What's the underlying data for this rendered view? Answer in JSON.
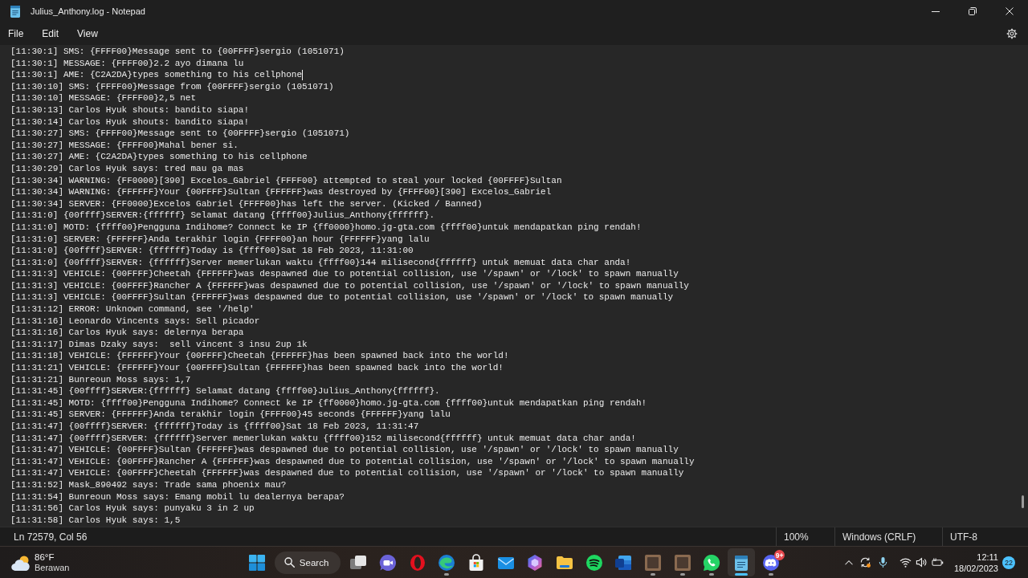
{
  "window": {
    "title": "Julius_Anthony.log - Notepad"
  },
  "menu": [
    "File",
    "Edit",
    "View"
  ],
  "editor": {
    "lines": [
      {
        "text": "[11:30:1] SMS: {FFFF00}Message sent to {00FFFF}sergio (1051071)",
        "caret": false
      },
      {
        "text": "[11:30:1] MESSAGE: {FFFF00}2.2 ayo dimana lu",
        "caret": false
      },
      {
        "text": "[11:30:1] AME: {C2A2DA}types something to his cellphone",
        "caret": true
      },
      {
        "text": "[11:30:10] SMS: {FFFF00}Message from {00FFFF}sergio (1051071)",
        "caret": false
      },
      {
        "text": "[11:30:10] MESSAGE: {FFFF00}2,5 net",
        "caret": false
      },
      {
        "text": "[11:30:13] Carlos Hyuk shouts: bandito siapa!",
        "caret": false
      },
      {
        "text": "[11:30:14] Carlos Hyuk shouts: bandito siapa!",
        "caret": false
      },
      {
        "text": "[11:30:27] SMS: {FFFF00}Message sent to {00FFFF}sergio (1051071)",
        "caret": false
      },
      {
        "text": "[11:30:27] MESSAGE: {FFFF00}Mahal bener si.",
        "caret": false
      },
      {
        "text": "[11:30:27] AME: {C2A2DA}types something to his cellphone",
        "caret": false
      },
      {
        "text": "[11:30:29] Carlos Hyuk says: tred mau ga mas",
        "caret": false
      },
      {
        "text": "[11:30:34] WARNING: {FF0000}[390] Excelos_Gabriel {FFFF00} attempted to steal your locked {00FFFF}Sultan",
        "caret": false
      },
      {
        "text": "[11:30:34] WARNING: {FFFFFF}Your {00FFFF}Sultan {FFFFFF}was destroyed by {FFFF00}[390] Excelos_Gabriel",
        "caret": false
      },
      {
        "text": "[11:30:34] SERVER: {FF0000}Excelos Gabriel {FFFF00}has left the server. (Kicked / Banned)",
        "caret": false
      },
      {
        "text": "[11:31:0] {00ffff}SERVER:{ffffff} Selamat datang {ffff00}Julius_Anthony{ffffff}.",
        "caret": false
      },
      {
        "text": "[11:31:0] MOTD: {ffff00}Pengguna Indihome? Connect ke IP {ff0000}homo.jg-gta.com {ffff00}untuk mendapatkan ping rendah!",
        "caret": false
      },
      {
        "text": "[11:31:0] SERVER: {FFFFFF}Anda terakhir login {FFFF00}an hour {FFFFFF}yang lalu",
        "caret": false
      },
      {
        "text": "[11:31:0] {00ffff}SERVER: {ffffff}Today is {ffff00}Sat 18 Feb 2023, 11:31:00",
        "caret": false
      },
      {
        "text": "[11:31:0] {00ffff}SERVER: {ffffff}Server memerlukan waktu {ffff00}144 milisecond{ffffff} untuk memuat data char anda!",
        "caret": false
      },
      {
        "text": "[11:31:3] VEHICLE: {00FFFF}Cheetah {FFFFFF}was despawned due to potential collision, use '/spawn' or '/lock' to spawn manually",
        "caret": false
      },
      {
        "text": "[11:31:3] VEHICLE: {00FFFF}Rancher A {FFFFFF}was despawned due to potential collision, use '/spawn' or '/lock' to spawn manually",
        "caret": false
      },
      {
        "text": "[11:31:3] VEHICLE: {00FFFF}Sultan {FFFFFF}was despawned due to potential collision, use '/spawn' or '/lock' to spawn manually",
        "caret": false
      },
      {
        "text": "[11:31:12] ERROR: Unknown command, see '/help'",
        "caret": false
      },
      {
        "text": "[11:31:16] Leonardo Vincents says: Sell picador",
        "caret": false
      },
      {
        "text": "[11:31:16] Carlos Hyuk says: delernya berapa",
        "caret": false
      },
      {
        "text": "[11:31:17] Dimas Dzaky says:  sell vincent 3 insu 2up 1k",
        "caret": false
      },
      {
        "text": "[11:31:18] VEHICLE: {FFFFFF}Your {00FFFF}Cheetah {FFFFFF}has been spawned back into the world!",
        "caret": false
      },
      {
        "text": "[11:31:21] VEHICLE: {FFFFFF}Your {00FFFF}Sultan {FFFFFF}has been spawned back into the world!",
        "caret": false
      },
      {
        "text": "[11:31:21] Bunreoun Moss says: 1,7",
        "caret": false
      },
      {
        "text": "[11:31:45] {00ffff}SERVER:{ffffff} Selamat datang {ffff00}Julius_Anthony{ffffff}.",
        "caret": false
      },
      {
        "text": "[11:31:45] MOTD: {ffff00}Pengguna Indihome? Connect ke IP {ff0000}homo.jg-gta.com {ffff00}untuk mendapatkan ping rendah!",
        "caret": false
      },
      {
        "text": "[11:31:45] SERVER: {FFFFFF}Anda terakhir login {FFFF00}45 seconds {FFFFFF}yang lalu",
        "caret": false
      },
      {
        "text": "[11:31:47] {00ffff}SERVER: {ffffff}Today is {ffff00}Sat 18 Feb 2023, 11:31:47",
        "caret": false
      },
      {
        "text": "[11:31:47] {00ffff}SERVER: {ffffff}Server memerlukan waktu {ffff00}152 milisecond{ffffff} untuk memuat data char anda!",
        "caret": false
      },
      {
        "text": "[11:31:47] VEHICLE: {00FFFF}Sultan {FFFFFF}was despawned due to potential collision, use '/spawn' or '/lock' to spawn manually",
        "caret": false
      },
      {
        "text": "[11:31:47] VEHICLE: {00FFFF}Rancher A {FFFFFF}was despawned due to potential collision, use '/spawn' or '/lock' to spawn manually",
        "caret": false
      },
      {
        "text": "[11:31:47] VEHICLE: {00FFFF}Cheetah {FFFFFF}was despawned due to potential collision, use '/spawn' or '/lock' to spawn manually",
        "caret": false
      },
      {
        "text": "[11:31:52] Mask_890492 says: Trade sama phoenix mau?",
        "caret": false
      },
      {
        "text": "[11:31:54] Bunreoun Moss says: Emang mobil lu dealernya berapa?",
        "caret": false
      },
      {
        "text": "[11:31:56] Carlos Hyuk says: punyaku 3 in 2 up",
        "caret": false
      },
      {
        "text": "[11:31:58] Carlos Hyuk says: 1,5",
        "caret": false
      }
    ]
  },
  "status_bar": {
    "position": "Ln 72579, Col 56",
    "zoom": "100%",
    "line_ending": "Windows (CRLF)",
    "encoding": "UTF-8"
  },
  "taskbar": {
    "weather": {
      "temperature": "86°F",
      "condition": "Berawan"
    },
    "search": {
      "label": "Search"
    },
    "apps": [
      {
        "kind": "taskview",
        "running": false,
        "active": false
      },
      {
        "kind": "videochat",
        "running": false,
        "active": false
      },
      {
        "kind": "ring",
        "running": false,
        "active": false
      },
      {
        "kind": "swirl",
        "running": true,
        "active": false
      },
      {
        "kind": "bag",
        "running": false,
        "active": false
      },
      {
        "kind": "mail",
        "running": false,
        "active": false
      },
      {
        "kind": "ribbon",
        "running": false,
        "active": false
      },
      {
        "kind": "folder",
        "running": false,
        "active": false
      },
      {
        "kind": "music",
        "running": false,
        "active": false
      },
      {
        "kind": "document",
        "running": false,
        "active": false
      },
      {
        "kind": "photo",
        "running": true,
        "active": false
      },
      {
        "kind": "photo",
        "running": true,
        "active": false
      },
      {
        "kind": "phone",
        "running": true,
        "active": false
      },
      {
        "kind": "notepad",
        "running": true,
        "active": true
      },
      {
        "kind": "gamepad",
        "running": true,
        "active": false,
        "badge": "9+"
      }
    ],
    "clock": {
      "time": "12:11",
      "date": "18/02/2023"
    },
    "notifications": "22"
  }
}
